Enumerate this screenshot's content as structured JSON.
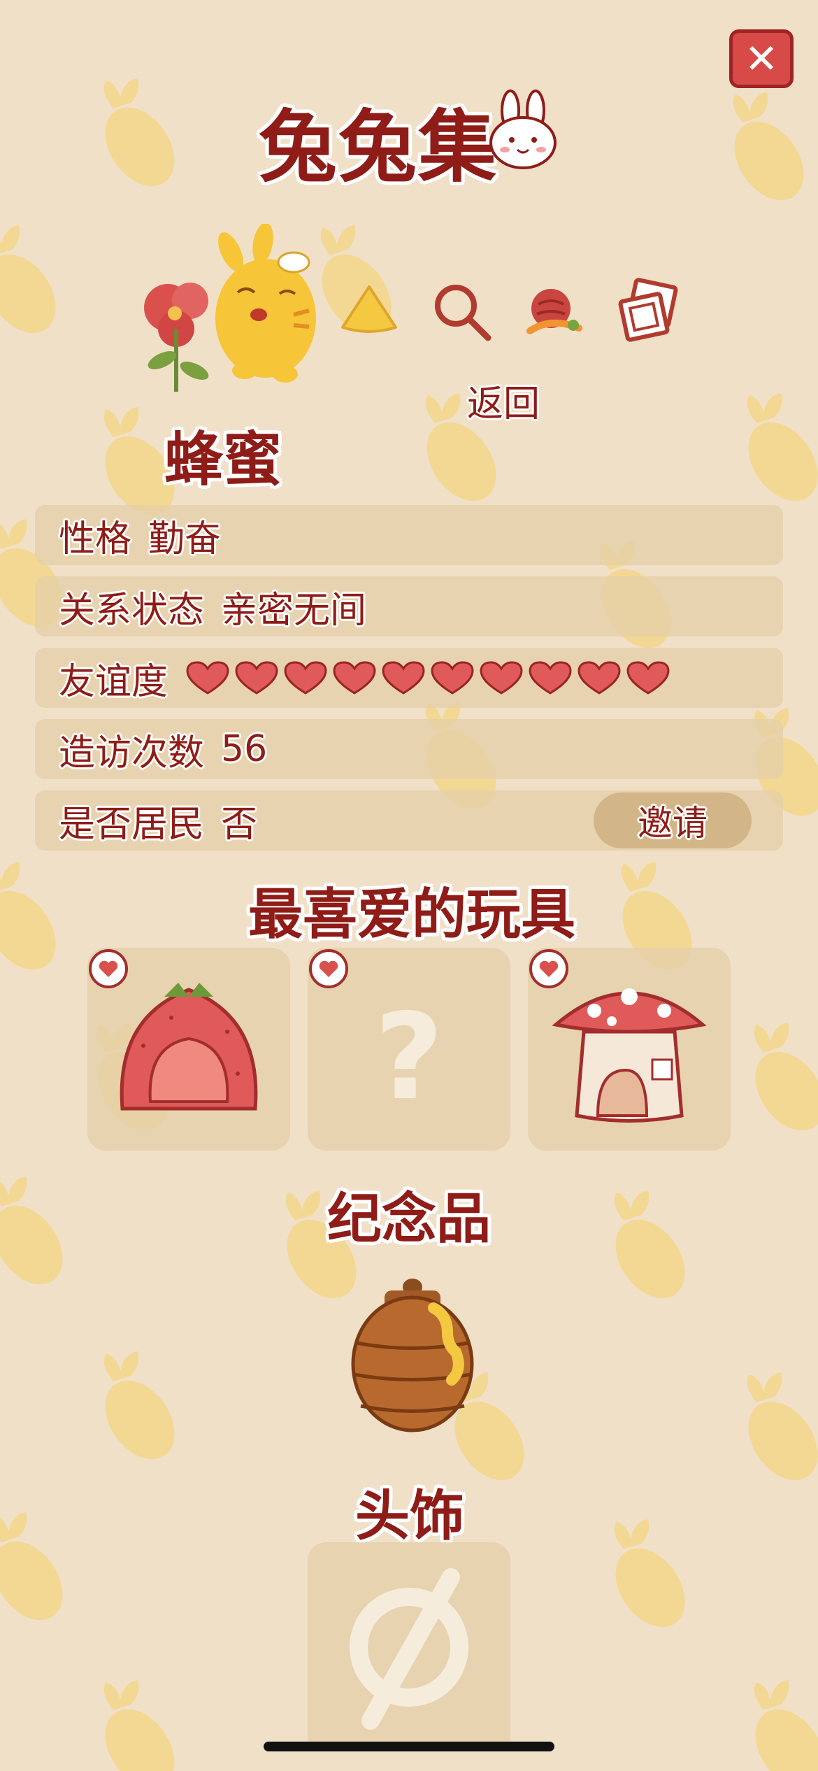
{
  "header": {
    "title": "兔兔集",
    "close_icon": "close-icon",
    "rabbit_icon": "rabbit-face-icon"
  },
  "toolbar": {
    "icons": [
      "honey-triangle-icon",
      "magnifier-icon",
      "food-basket-icon",
      "photo-icon"
    ],
    "back_label": "返回"
  },
  "character": {
    "name": "蜂蜜",
    "icon": "bee-bunny-character-icon"
  },
  "info": {
    "personality": {
      "label": "性格",
      "value": "勤奋"
    },
    "relationship": {
      "label": "关系状态",
      "value": "亲密无间"
    },
    "friendship": {
      "label": "友谊度",
      "hearts_filled": 10,
      "hearts_total": 10
    },
    "visits": {
      "label": "造访次数",
      "value": "56"
    },
    "resident": {
      "label": "是否居民",
      "value": "否",
      "invite_label": "邀请"
    }
  },
  "toys": {
    "title": "最喜爱的玩具",
    "items": [
      {
        "icon": "strawberry-house-icon",
        "badge": "heart-badge-icon"
      },
      {
        "icon": "unknown-question-icon",
        "badge": "heart-badge-icon"
      },
      {
        "icon": "mushroom-house-icon",
        "badge": "heart-badge-icon"
      }
    ]
  },
  "souvenir": {
    "title": "纪念品",
    "icon": "honey-pot-icon"
  },
  "headwear": {
    "title": "头饰",
    "icon": "empty-set-icon"
  },
  "colors": {
    "background": "#f1e0c8",
    "text_red": "#8f1c17",
    "heart_red": "#e05a5a",
    "panel": "#e5cfa9",
    "carrot": "#f2d68a"
  }
}
